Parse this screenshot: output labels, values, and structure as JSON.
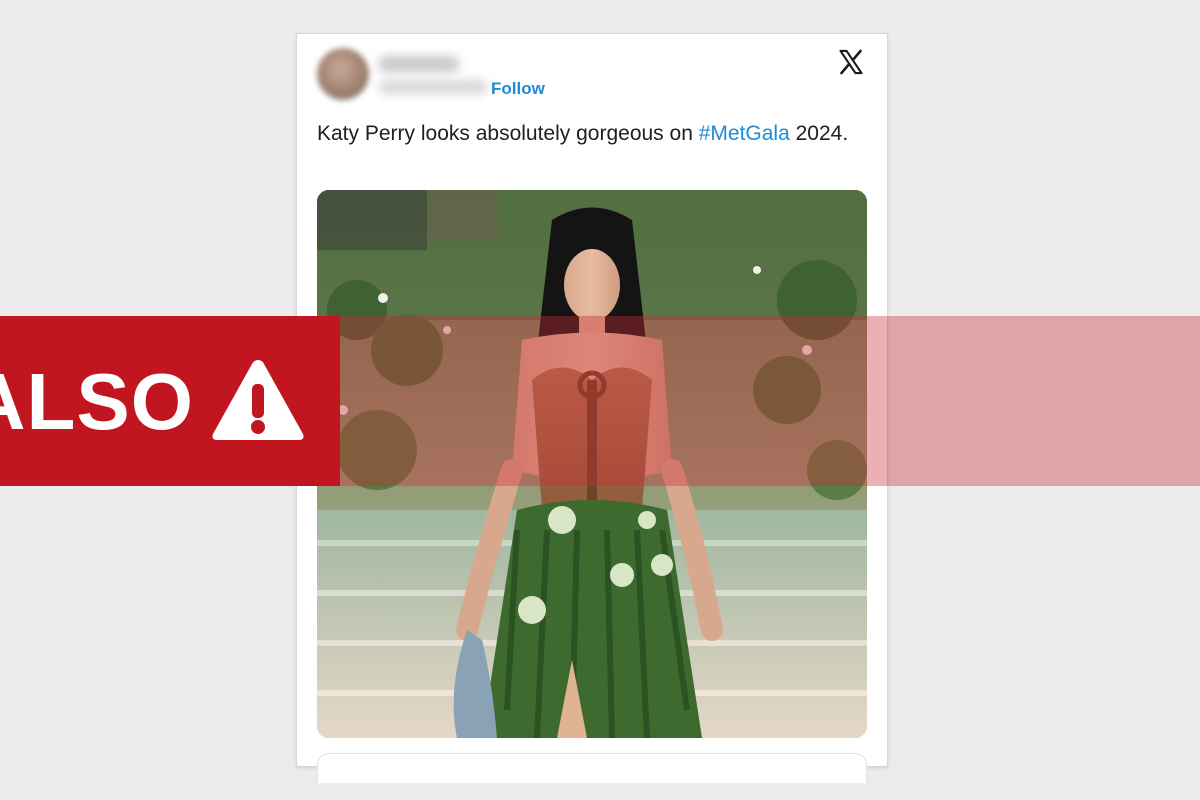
{
  "tweet": {
    "follow_label": "Follow",
    "text_before": "Katy Perry looks absolutely gorgeous on ",
    "hashtag": "#MetGala",
    "text_after": " 2024.",
    "logo_icon": "x-logo-icon"
  },
  "banner": {
    "label": "ALSO",
    "icon": "warning-triangle-icon",
    "color": "#c1151f"
  },
  "colors": {
    "link": "#1d8cd8",
    "background": "#ececec"
  }
}
